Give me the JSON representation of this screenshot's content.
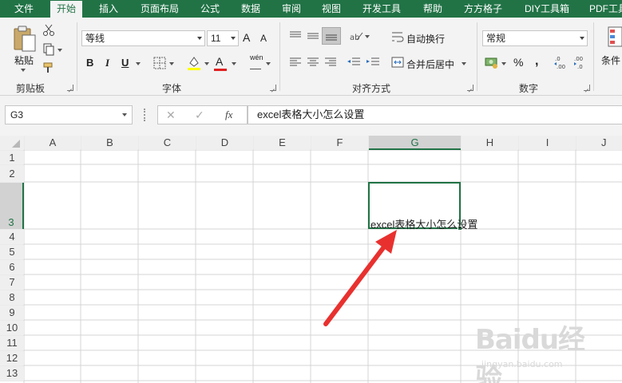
{
  "tabs": [
    {
      "label": "文件",
      "active": false
    },
    {
      "label": "开始",
      "active": true
    },
    {
      "label": "插入",
      "active": false
    },
    {
      "label": "页面布局",
      "active": false
    },
    {
      "label": "公式",
      "active": false
    },
    {
      "label": "数据",
      "active": false
    },
    {
      "label": "审阅",
      "active": false
    },
    {
      "label": "视图",
      "active": false
    },
    {
      "label": "开发工具",
      "active": false
    },
    {
      "label": "帮助",
      "active": false
    },
    {
      "label": "方方格子",
      "active": false
    },
    {
      "label": "DIY工具箱",
      "active": false
    },
    {
      "label": "PDF工具",
      "active": false
    }
  ],
  "ribbon": {
    "clipboard": {
      "group_label": "剪贴板",
      "paste_label": "粘贴"
    },
    "font": {
      "group_label": "字体",
      "font_name": "等线",
      "font_size": "11",
      "grow_label": "A",
      "shrink_label": "A",
      "bold": "B",
      "italic": "I",
      "underline": "U",
      "font_color_label": "A",
      "phonetic_label": "wén"
    },
    "alignment": {
      "group_label": "对齐方式",
      "wrap_text": "自动换行",
      "merge_center": "合并后居中"
    },
    "number": {
      "group_label": "数字",
      "format": "常规",
      "percent": "%",
      "comma": ","
    },
    "styles": {
      "conditional_label": "条件"
    }
  },
  "formula_bar": {
    "name_box": "G3",
    "cancel": "✕",
    "enter": "✓",
    "fx": "fx",
    "content": "excel表格大小怎么设置"
  },
  "grid": {
    "columns": [
      "A",
      "B",
      "C",
      "D",
      "E",
      "F",
      "G",
      "H",
      "I",
      "J"
    ],
    "rows": [
      "1",
      "2",
      "3",
      "4",
      "5",
      "6",
      "7",
      "8",
      "9",
      "10",
      "11",
      "12",
      "13"
    ],
    "selected_column": "G",
    "selected_row": "3",
    "cell_G3": "excel表格大小怎么设置"
  },
  "annotation": {
    "arrow_color": "#e8312f"
  },
  "watermark": {
    "brand": "Baidu经验",
    "url": "jingyan.baidu.com"
  },
  "colors": {
    "accent": "#217346",
    "ribbon_bg": "#f3f3f3",
    "gridline": "#d4d4d4",
    "header_bg": "#efefef"
  }
}
